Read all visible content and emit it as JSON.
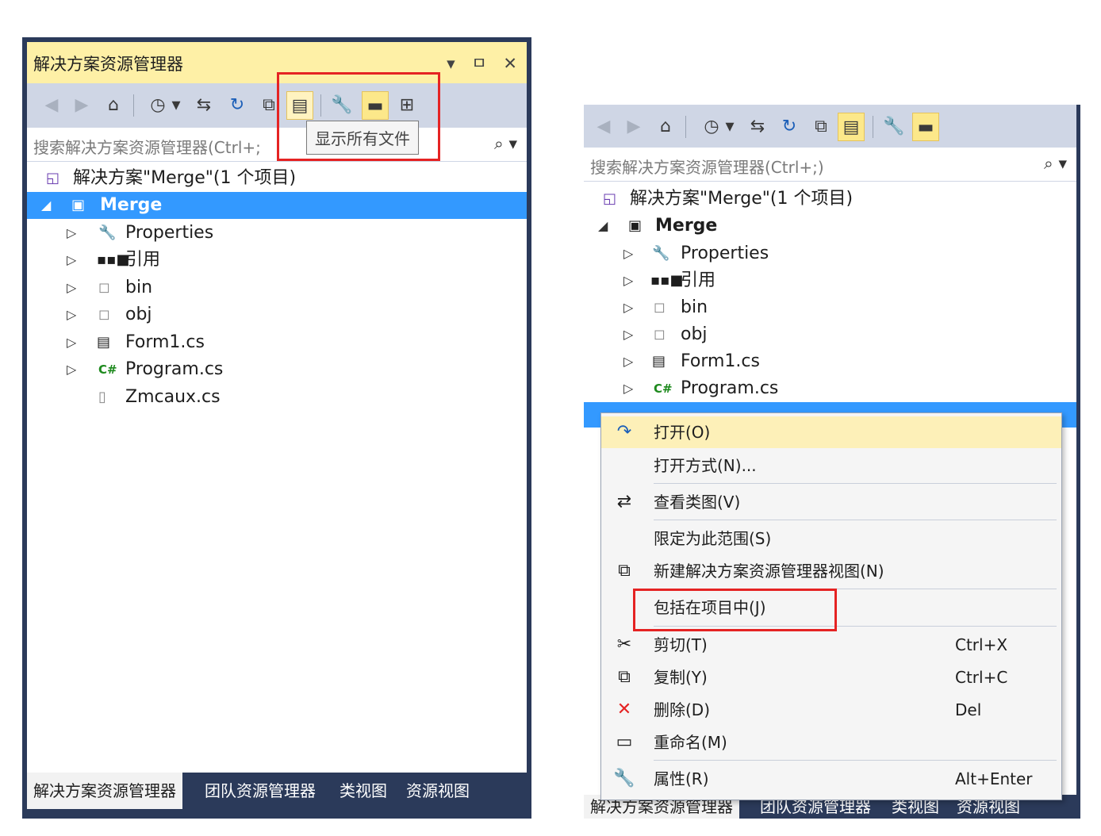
{
  "left_panel": {
    "title": "解决方案资源管理器",
    "title_buttons": [
      "▾",
      "ㅁ",
      "✕"
    ],
    "search_placeholder": "搜索解决方案资源管理器(Ctrl+;",
    "tooltip": "显示所有文件",
    "tree": {
      "solution": "解决方案\"Merge\"(1 个项目)",
      "project": "Merge",
      "items": [
        "Properties",
        "引用",
        "bin",
        "obj",
        "Form1.cs",
        "Program.cs",
        "Zmcaux.cs"
      ]
    },
    "tabs": [
      "解决方案资源管理器",
      "团队资源管理器",
      "类视图",
      "资源视图"
    ]
  },
  "right_panel": {
    "search_placeholder": "搜索解决方案资源管理器(Ctrl+;)",
    "tree": {
      "solution": "解决方案\"Merge\"(1 个项目)",
      "project": "Merge",
      "items": [
        "Properties",
        "引用",
        "bin",
        "obj",
        "Form1.cs",
        "Program.cs"
      ]
    },
    "context_menu": {
      "items": [
        {
          "label": "打开(O)",
          "shortcut": ""
        },
        {
          "label": "打开方式(N)...",
          "shortcut": ""
        },
        {
          "label": "查看类图(V)",
          "shortcut": ""
        },
        {
          "label": "限定为此范围(S)",
          "shortcut": ""
        },
        {
          "label": "新建解决方案资源管理器视图(N)",
          "shortcut": ""
        },
        {
          "label": "包括在项目中(J)",
          "shortcut": ""
        },
        {
          "label": "剪切(T)",
          "shortcut": "Ctrl+X"
        },
        {
          "label": "复制(Y)",
          "shortcut": "Ctrl+C"
        },
        {
          "label": "删除(D)",
          "shortcut": "Del"
        },
        {
          "label": "重命名(M)",
          "shortcut": ""
        },
        {
          "label": "属性(R)",
          "shortcut": "Alt+Enter"
        }
      ]
    },
    "tabs": [
      "解决方案资源管理器",
      "团队资源管理器",
      "类视图",
      "资源视图"
    ]
  },
  "colors": {
    "title_bg": "#fef0a6",
    "toolbar_bg": "#cfd6e5",
    "selection": "#3399ff",
    "frame": "#2b3a5a",
    "highlight_box": "#e52323",
    "menu_hover": "#fdf0b8"
  }
}
